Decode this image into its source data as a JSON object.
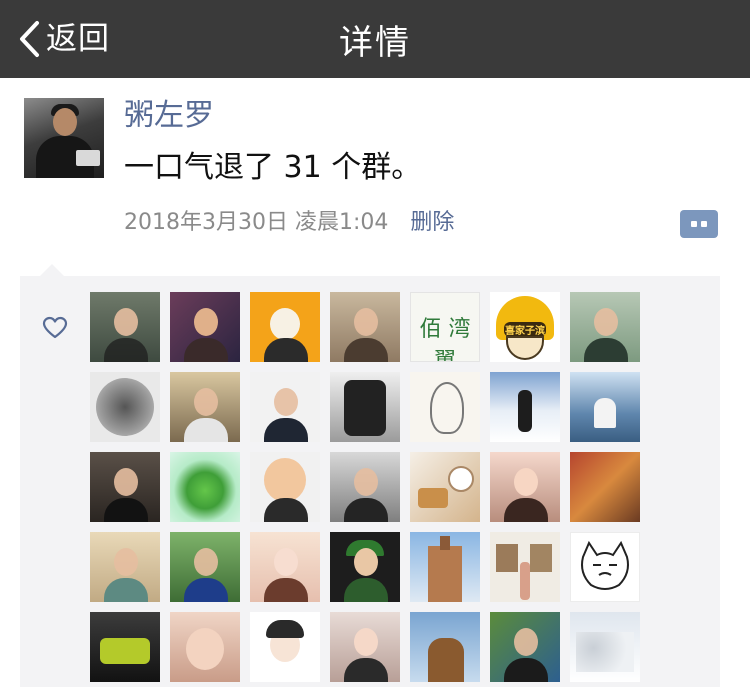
{
  "nav": {
    "back_label": "返回",
    "title": "详情"
  },
  "post": {
    "username": "粥左罗",
    "content": "一口气退了 31 个群。",
    "timestamp": "2018年3月30日 凌晨1:04",
    "delete_label": "删除"
  },
  "colors": {
    "navbar": "#3a3a3a",
    "link": "#576b95",
    "likes_bg": "#f3f3f5"
  },
  "likes": {
    "tile_texts": {
      "2": "",
      "11": "",
      "25": ""
    },
    "badge_text": "喜家子滨",
    "calligraphy_text": "佰 湾 翼"
  }
}
